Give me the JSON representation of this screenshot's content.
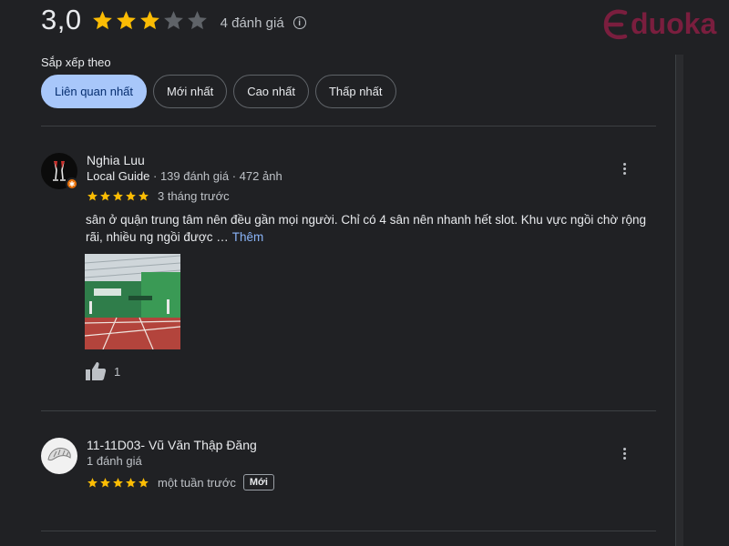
{
  "summary": {
    "rating": "3,0",
    "stars_filled": 3,
    "stars_total": 5,
    "review_count": "4 đánh giá",
    "info_symbol": "i"
  },
  "logo": {
    "text": "duoka",
    "color": "#7a1e3e"
  },
  "sort": {
    "label": "Sắp xếp theo",
    "options": [
      "Liên quan nhất",
      "Mới nhất",
      "Cao nhất",
      "Thấp nhất"
    ],
    "selected": "Liên quan nhất"
  },
  "reviews": [
    {
      "name": "Nghia Luu",
      "badge": "Local Guide",
      "stats": " · 139 đánh giá · 472 ảnh",
      "rating": 5,
      "time": "3 tháng trước",
      "text": "sân ở quận trung tâm nên đều gần mọi người. Chỉ có 4 sân nên nhanh hết slot. Khu vực ngồi chờ rộng rãi, nhiều ng ngồi được …",
      "see_more": "Thêm",
      "likes": "1",
      "avatar_icon": "champagne-glasses-icon",
      "photo": "badminton-court-photo"
    },
    {
      "name": "11-11D03- Vũ Văn Thập Đăng",
      "stats": "1 đánh giá",
      "rating": 5,
      "time": "một tuần trước",
      "new_label": "Mới",
      "avatar_icon": "croissant-icon"
    }
  ],
  "colors": {
    "background": "#202124",
    "star": "#fbbc04",
    "star_empty": "#5f6368",
    "chip_active": "#a8c7fa",
    "link": "#8ab4f8"
  }
}
